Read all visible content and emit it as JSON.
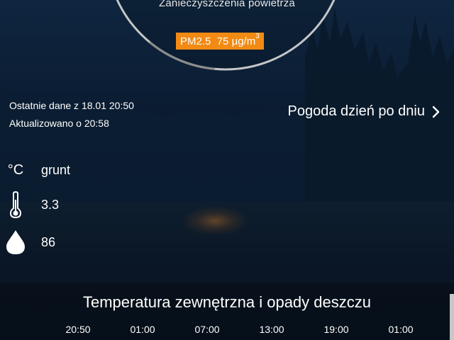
{
  "air_quality": {
    "subtitle": "Zanieczyszczenia powietrza",
    "pm_label": "PM2.5",
    "pm_value": "75",
    "pm_unit": "µg/m",
    "pm_unit_sup": "3",
    "gauge_level_fraction": 0.62,
    "badge_color": "#f28a13"
  },
  "status": {
    "last_data": "Ostatnie dane z 18.01 20:50",
    "updated": "Aktualizowano o 20:58"
  },
  "daily_forecast_link": "Pogoda dzień po dniu",
  "sensors": {
    "unit_symbol": "°C",
    "location": "grunt",
    "temperature": "3.3",
    "humidity": "86",
    "temperature_icon": "thermometer-icon",
    "humidity_icon": "water-drop-icon"
  },
  "chart": {
    "title": "Temperatura zewnętrzna i opady deszczu",
    "times": [
      "20:50",
      "01:00",
      "07:00",
      "13:00",
      "19:00",
      "01:00"
    ]
  }
}
